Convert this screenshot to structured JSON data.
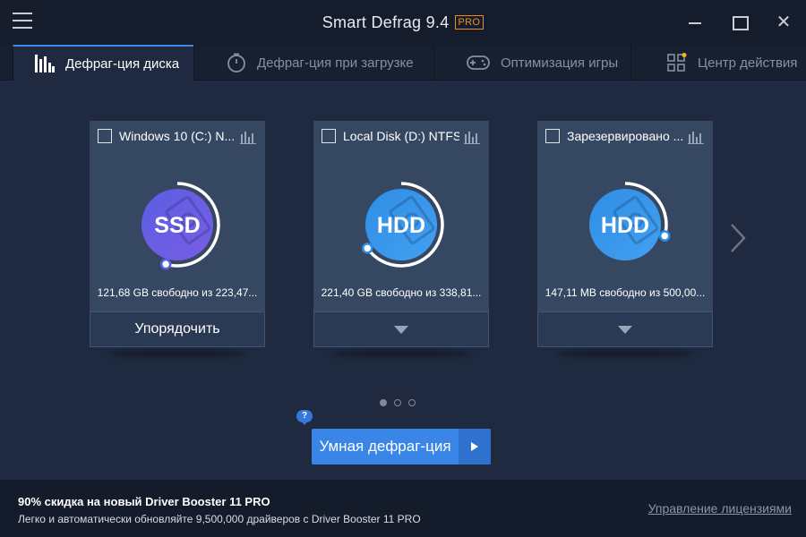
{
  "app": {
    "title": "Smart Defrag 9.4",
    "badge": "PRO",
    "accent_color": "#3a86e8",
    "badge_color": "#f08a24"
  },
  "window_controls": [
    "minimize-icon",
    "maximize-icon",
    "close-icon"
  ],
  "tabs": [
    {
      "label": "Дефраг-ция диска",
      "icon": "disk-defrag-icon",
      "active": true
    },
    {
      "label": "Дефраг-ция при загрузке",
      "icon": "boot-timer-icon",
      "active": false
    },
    {
      "label": "Оптимизация игры",
      "icon": "gamepad-icon",
      "active": false
    },
    {
      "label": "Центр действия",
      "icon": "action-center-icon",
      "active": false
    }
  ],
  "disks": [
    {
      "name": "Windows 10 (C:) N...",
      "type": "SSD",
      "info": "121,68 GB свободно из 223,47...",
      "free_fraction": 0.545,
      "gradient": [
        "#5a5ee3",
        "#7a5de6"
      ],
      "action_label": "Упорядочить",
      "checked": false
    },
    {
      "name": "Local Disk (D:) NTFS",
      "type": "HDD",
      "info": "221,40 GB свободно из 338,81...",
      "free_fraction": 0.653,
      "gradient": [
        "#2f8de6",
        "#43a0f0"
      ],
      "action_label": "",
      "checked": false
    },
    {
      "name": "Зарезервировано ...",
      "type": "HDD",
      "info": "147,11 MB свободно из 500,00...",
      "free_fraction": 0.294,
      "gradient": [
        "#2f8de6",
        "#43a0f0"
      ],
      "action_label": "",
      "checked": false
    }
  ],
  "pager": {
    "pages": 3,
    "current": 1
  },
  "main_action": {
    "help": "?",
    "label": "Умная дефраг-ция"
  },
  "footer": {
    "promo_title": "90% скидка на новый Driver Booster 11 PRO",
    "promo_text": "Легко и автоматически обновляйте 9,500,000 драйверов с Driver Booster 11 PRO",
    "license_link": "Управление лицензиями"
  }
}
